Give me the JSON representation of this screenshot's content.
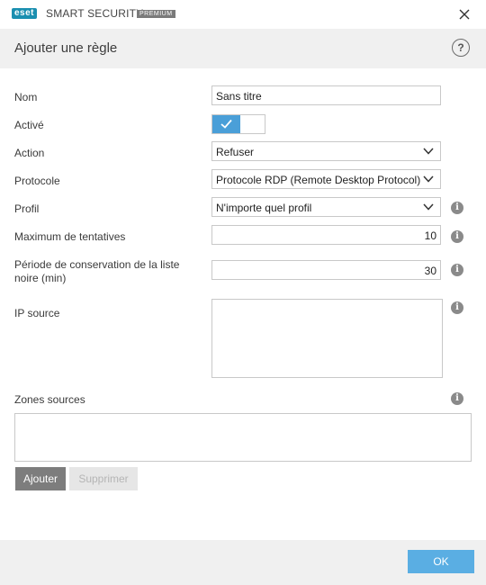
{
  "window": {
    "logo_text": "eset",
    "product_name": "SMART SECURITY",
    "edition_badge": "PREMIUM"
  },
  "header": {
    "title": "Ajouter une règle",
    "help_label": "?"
  },
  "form": {
    "name": {
      "label": "Nom",
      "value": "Sans titre"
    },
    "enabled": {
      "label": "Activé",
      "state": true
    },
    "action": {
      "label": "Action",
      "value": "Refuser"
    },
    "protocol": {
      "label": "Protocole",
      "value": "Protocole RDP (Remote Desktop Protocol)"
    },
    "profile": {
      "label": "Profil",
      "value": "N'importe quel profil"
    },
    "max_attempts": {
      "label": "Maximum de tentatives",
      "value": "10"
    },
    "retention": {
      "label": "Période de conservation de la liste noire (min)",
      "value": "30"
    },
    "source_ip": {
      "label": "IP source",
      "value": ""
    }
  },
  "zones": {
    "label": "Zones sources",
    "add_label": "Ajouter",
    "remove_label": "Supprimer"
  },
  "footer": {
    "ok_label": "OK"
  },
  "icons": {
    "close": "close-icon",
    "help": "help-icon",
    "info": "info-icon",
    "chevron": "chevron-down-icon",
    "check": "check-icon"
  },
  "colors": {
    "accent": "#4a9fd8",
    "ok_button": "#5aaee3",
    "logo": "#1a8fb0"
  }
}
